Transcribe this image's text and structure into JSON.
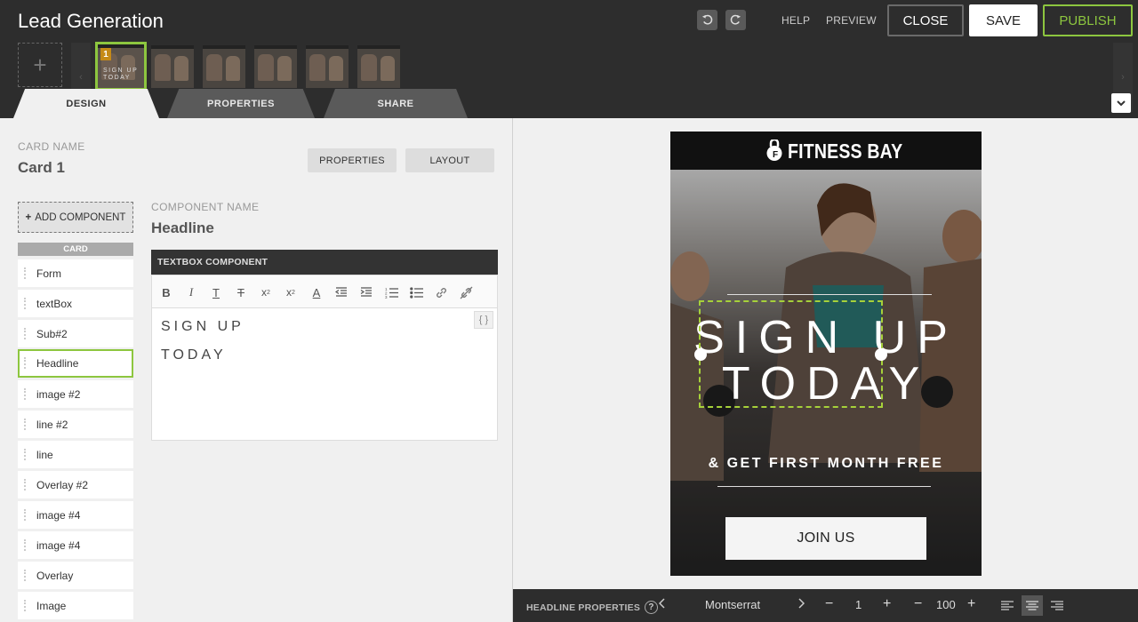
{
  "app": {
    "title": "Lead Generation"
  },
  "header": {
    "help": "HELP",
    "preview": "PREVIEW",
    "close": "CLOSE",
    "save": "SAVE",
    "publish": "PUBLISH",
    "add_card": "+"
  },
  "thumbnails": {
    "active_number": "1",
    "active_text": "SIGN UP TODAY",
    "count": 6
  },
  "tabs": {
    "design": "DESIGN",
    "properties": "PROPERTIES",
    "share": "SHARE"
  },
  "card": {
    "name_label": "CARD NAME",
    "name": "Card 1",
    "properties_btn": "PROPERTIES",
    "layout_btn": "LAYOUT"
  },
  "components": {
    "add_label": "ADD COMPONENT",
    "group_header": "CARD",
    "items": [
      "Form",
      "textBox",
      "Sub#2",
      "Headline",
      "image #2",
      "line #2",
      "line",
      "Overlay #2",
      "image #4",
      "image #4",
      "Overlay",
      "Image"
    ],
    "selected": "Headline"
  },
  "component_editor": {
    "name_label": "COMPONENT NAME",
    "name": "Headline",
    "type_header": "TEXTBOX COMPONENT",
    "lines": [
      "SIGN UP",
      "TODAY"
    ],
    "code_toggle": "{ }"
  },
  "preview": {
    "brand": "FITNESS BAY",
    "logo_letter": "F",
    "headline_line1": "SIGN UP",
    "headline_line2": "TODAY",
    "subheadline": "& GET FIRST MONTH FREE",
    "cta": "JOIN US"
  },
  "bottom_bar": {
    "label": "HEADLINE PROPERTIES",
    "font": "Montserrat",
    "line_height": "1",
    "size": "100"
  },
  "colors": {
    "accent": "#8dc63f",
    "topbar": "#2d2d2d",
    "panel": "#f0f0f0"
  }
}
